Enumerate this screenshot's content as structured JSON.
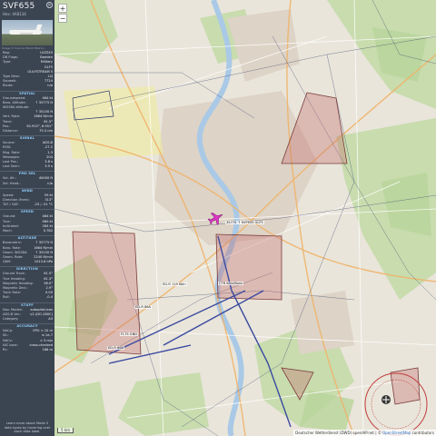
{
  "sidebar": {
    "callsign": "SVF655",
    "hex": "Hex:  4A8134",
    "close_icon": "close-icon",
    "photo_caption": "Image © Duncan Monk Malkm...",
    "info": [
      {
        "k": "Reg:",
        "v": "LVZZX5"
      },
      {
        "k": "DB Flags:",
        "v": "Sweden"
      },
      {
        "k": "Type:",
        "v": "Military"
      },
      {
        "k": "",
        "v": "GLF5"
      },
      {
        "k": "",
        "v": "GULFSTREAM 5"
      },
      {
        "k": "Type Desc:",
        "v": "L2J"
      },
      {
        "k": "Squawk:",
        "v": "7724"
      },
      {
        "k": "Route:",
        "v": "n/a"
      }
    ],
    "spatial_title": "SPATIAL",
    "spatial": [
      {
        "k": "Groundspeed:",
        "v": "484 kt"
      },
      {
        "k": "Baro. Altitude:",
        "v": "↑ 35775 ft"
      },
      {
        "k": "WGS84 altitude:",
        "v": ""
      },
      {
        "k": "",
        "v": "↑ 35150 ft"
      },
      {
        "k": "Vert. Rate:",
        "v": "1664 ft/min"
      },
      {
        "k": "Track:",
        "v": "61.5°"
      },
      {
        "k": "Pos.:",
        "v": "50.915°, 6.951°"
      },
      {
        "k": "Distance:",
        "v": "75.3 nm"
      }
    ],
    "signal_title": "SIGNAL",
    "signal": [
      {
        "k": "Source:",
        "v": "ADS-B"
      },
      {
        "k": "RSSI:",
        "v": "-27.2"
      },
      {
        "k": "Msg. Rate:",
        "v": "1.3"
      },
      {
        "k": "Messages:",
        "v": "204"
      },
      {
        "k": "Last Pos.:",
        "v": "3.8 s"
      },
      {
        "k": "Last Seen:",
        "v": "3.5 s"
      }
    ],
    "fms_title": "FMS SEL",
    "fms": [
      {
        "k": "Sel. Alt.:",
        "v": "40000 ft"
      },
      {
        "k": "Sel. Head.:",
        "v": "n/a"
      }
    ],
    "wind_title": "WIND",
    "wind": [
      {
        "k": "Speed:",
        "v": "59 kt"
      },
      {
        "k": "Direction (from):",
        "v": "313°"
      },
      {
        "k": "TAT / OAT:",
        "v": "-23 / -51 °C"
      }
    ],
    "speed_title": "SPEED",
    "speed": [
      {
        "k": "Ground:",
        "v": "484 kt"
      },
      {
        "k": "True:",
        "v": "460 kt"
      },
      {
        "k": "Indicated:",
        "v": "284 kt"
      },
      {
        "k": "Mach:",
        "v": "0.782"
      }
    ],
    "altitude_title": "ALTITUDE",
    "altitude": [
      {
        "k": "Barometric:",
        "v": "↑ 35775 ft"
      },
      {
        "k": "Baro. Rate:",
        "v": "1664 ft/min"
      },
      {
        "k": "Geom. WGS84:",
        "v": "↑ 35150 ft"
      },
      {
        "k": "Geom. Rate:",
        "v": "2240 ft/min"
      },
      {
        "k": "QNH:",
        "v": "1013.6 hPa"
      }
    ],
    "direction_title": "DIRECTION",
    "direction": [
      {
        "k": "Ground Track:",
        "v": "61.5°"
      },
      {
        "k": "True Heading:",
        "v": "61.3°"
      },
      {
        "k": "Magnetic Heading:",
        "v": "58.0°"
      },
      {
        "k": "Magnetic Decl.:",
        "v": "2.9°"
      },
      {
        "k": "Track Rate:",
        "v": "0.00"
      },
      {
        "k": "Roll:",
        "v": "-0.4"
      }
    ],
    "stuff_title": "STUFF",
    "stuff": [
      {
        "k": "Nav. Modes:",
        "v": "autopilot,tcas"
      },
      {
        "k": "ADS-B Ver.:",
        "v": "v2 (DO-260C)"
      },
      {
        "k": "Category:",
        "v": "A3"
      }
    ],
    "accuracy_title": "ACCURACY",
    "accuracy": [
      {
        "k": "NACp:",
        "v": "EPU < 10 m"
      },
      {
        "k": "SIL:",
        "v": "≤ 1e-7"
      },
      {
        "k": "NACv:",
        "v": "< 3 m/s"
      },
      {
        "k": "NIC baro:",
        "v": "cross-checked"
      },
      {
        "k": "Rc:",
        "v": "186 m"
      }
    ],
    "footer": "Learn more about Mode S data types by hovering over each data label."
  },
  "map": {
    "zoom_in": "+",
    "zoom_out": "−",
    "scale_label": "5 km",
    "attribution_text": "Deutscher Wetterdienst (DWD) openAIP.net | © ",
    "attribution_link": "OpenStreetMap",
    "attribution_tail": " contributors",
    "labels": [
      {
        "id": "aircraft-label",
        "text": "35775 ↑ SVF655 GLF5"
      },
      {
        "id": "zone-label-1",
        "text": "ED-R 119 Köln"
      },
      {
        "id": "zone-label-2",
        "text": "ED-R 86A"
      },
      {
        "id": "zone-label-3",
        "text": "ED-R 86B"
      },
      {
        "id": "zone-label-4",
        "text": "CTR Köln/Bonn"
      },
      {
        "id": "zone-label-5",
        "text": "FL75 GND"
      }
    ]
  }
}
